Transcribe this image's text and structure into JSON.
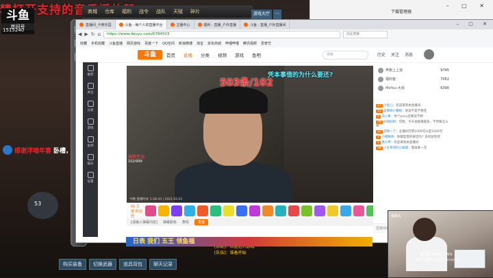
{
  "stream_banner": "精打开支持的音乐播放器",
  "game": {
    "logo": "斗鱼",
    "logo_sub": "房间号",
    "room_id": "1515240",
    "menu": [
      "商城",
      "仓库",
      "福利",
      "战令",
      "战队",
      "天赋",
      "碎片"
    ],
    "right_tabs": [
      "游戏大厅",
      "…"
    ],
    "danmu_red": "感谢浮喵年喜",
    "danmu_white": "卧槽，哈哈哈",
    "minimap_value": "53",
    "bottom_buttons": [
      "购买装备",
      "切换武器",
      "道具背包",
      "聊天记录"
    ],
    "chat_lines": [
      "[系统]：欢迎进入游戏",
      "[队伍]：准备开始"
    ]
  },
  "browser_back": {
    "title": "下载管理器",
    "controls": "– ▢ ✕"
  },
  "browser": {
    "tabs": [
      {
        "label": "直播间_卡牌乐园",
        "active": false
      },
      {
        "label": "斗鱼 - 每个人的直播平台",
        "active": true
      },
      {
        "label": "主播中心",
        "active": false
      },
      {
        "label": "福利 - 直播_户外直播",
        "active": false
      },
      {
        "label": "斗鱼 - 直播_户外直播间",
        "active": false
      }
    ],
    "controls": "– ▢ ✕",
    "url": "https://www.douyu.com/6784503",
    "search_placeholder": "点此搜索",
    "bookmarks": [
      "收藏",
      "手机收藏",
      "斗鱼直播",
      "网页游戏",
      "百度一下",
      "QQ空间",
      "新浪微博",
      "淘宝",
      "京东商城",
      "哔哩哔哩",
      "腾讯视频",
      "爱奇艺"
    ]
  },
  "douyu": {
    "logo": "斗鱼",
    "nav": [
      "首页",
      "直播",
      "分类",
      "视频",
      "游戏",
      "鱼吧"
    ],
    "search_placeholder": "搜索",
    "right": [
      "历史",
      "关注",
      "消息"
    ],
    "sidebar": [
      "推荐",
      "关注",
      "分类",
      "游戏",
      "鱼吧",
      "娱乐",
      "设置"
    ]
  },
  "video": {
    "counter": "503条/102",
    "question": "凭本事借的为什么要还?",
    "tag_red": "做题互动",
    "tag_white": "102/999",
    "timestamp": "今晚 直播时长 1:28:45 | 2021.05.01"
  },
  "gifts": {
    "label": "6K 主播 粉丝团",
    "colors": [
      "#e14b8a",
      "#f7b500",
      "#7a3ff0",
      "#2bb0e8",
      "#f05a28",
      "#28c07a",
      "#e8e028",
      "#3a6ff0",
      "#c03ad8",
      "#f08a28",
      "#28b0c0",
      "#e84848",
      "#7ac028",
      "#a058f0",
      "#f0c828",
      "#38a8e8",
      "#e85898",
      "#58c058"
    ]
  },
  "chat_input": {
    "placeholder": "[请输入弹幕内容]",
    "options": [
      "弹幕颜色",
      "表情",
      "发送"
    ],
    "send": "发送"
  },
  "rank": [
    {
      "name": "奔跑上上道",
      "value": "9745"
    },
    {
      "name": "福利官",
      "value": "7052"
    },
    {
      "name": "MeYou-大叔",
      "value": "6390"
    }
  ],
  "chat": [
    {
      "badge": "21",
      "nick": "小鱼儿",
      "text": "欢迎来到本直播间"
    },
    {
      "badge": "15",
      "nick": "蓝莓味小樱桃",
      "text": "他说不是不想还"
    },
    {
      "badge": "8",
      "nick": "开心果",
      "text": "你个pony还要说不想"
    },
    {
      "badge": "20",
      "nick": "好呀好呀",
      "text": "贷款，今天会越来越多，不然要怎么样"
    },
    {
      "badge": "12",
      "nick": "贷款一下",
      "text": "主播好厉害1000可以是1000元"
    },
    {
      "badge": "9",
      "nick": "小猪佩奇",
      "text": "你都是借的要还吗？多的就吃吧"
    },
    {
      "badge": "5",
      "nick": "路人甲",
      "text": "欢迎来到本直播间"
    },
    {
      "badge": "18",
      "nick": "少主哥哥的小嘘嘘",
      "text": "我再来一次"
    }
  ],
  "chat_tools": "屏蔽特效 | 弹幕设置",
  "bottom_banner": "日表 我们 五王 领鱼福",
  "webcam": {
    "tag": "摄像头",
    "watermark": "激活 Windows",
    "watermark_sub": "转到\"设置\"以激活 Windows。"
  }
}
